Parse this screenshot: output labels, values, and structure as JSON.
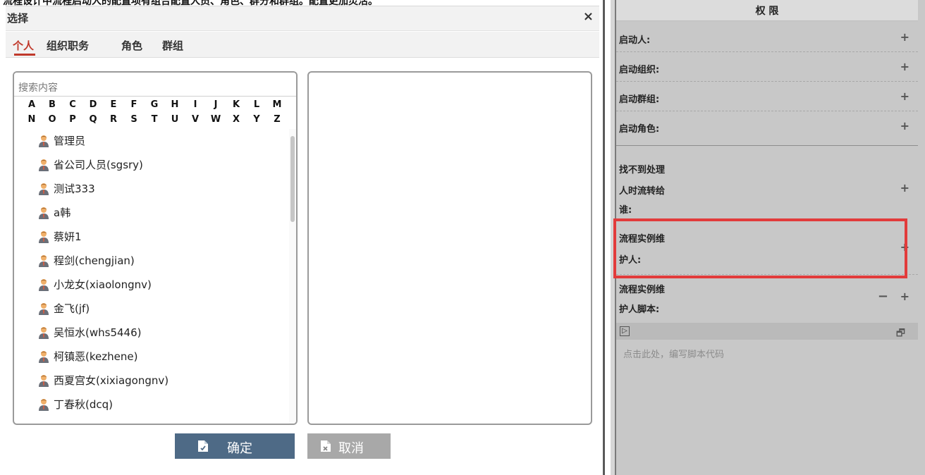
{
  "banner": {
    "text": "流程设计中流程启动人的配置项有组合配置人员、角色、群分和群组。配置更加灵活。"
  },
  "dialog": {
    "title": "选择",
    "close_symbol": "×",
    "tabs": [
      {
        "label": "个人",
        "active": true
      },
      {
        "label": "组织职务",
        "active": false
      },
      {
        "label": "角色",
        "active": false
      },
      {
        "label": "群组",
        "active": false
      }
    ],
    "search_placeholder": "搜索内容",
    "alphabet_row1": [
      "A",
      "B",
      "C",
      "D",
      "E",
      "F",
      "G",
      "H",
      "I",
      "J",
      "K",
      "L",
      "M"
    ],
    "alphabet_row2": [
      "N",
      "O",
      "P",
      "Q",
      "R",
      "S",
      "T",
      "U",
      "V",
      "W",
      "X",
      "Y",
      "Z"
    ],
    "users": [
      "管理员",
      "省公司人员(sgsry)",
      "测试333",
      "a韩",
      "蔡妍1",
      "程剑(chengjian)",
      "小龙女(xiaolongnv)",
      "金飞(jf)",
      "吴恒水(whs5446)",
      "柯镇恶(kezhene)",
      "西夏宫女(xixiagongnv)",
      "丁春秋(dcq)"
    ],
    "buttons": {
      "ok": "确定",
      "cancel": "取消"
    }
  },
  "permissions": {
    "header": "权 限",
    "start_user_label": "启动人:",
    "start_org_label": "启动组织:",
    "start_group_label": "启动群组:",
    "start_role_label": "启动角色:",
    "fallback_label_line1": "找不到处理",
    "fallback_label_line2": "人时流转给",
    "fallback_label_line3": "谁:",
    "maintainer_label_line1": "流程实例维",
    "maintainer_label_line2": "护人:",
    "maintainer_script_label_line1": "流程实例维",
    "maintainer_script_label_line2": "护人脚本:",
    "plus_symbol": "+",
    "minus_symbol": "−",
    "script_expand_symbol": "▷",
    "script_max_symbol": "🗗",
    "script_placeholder": "点击此处，编写脚本代码"
  },
  "colors": {
    "tab_active": "#c0392b",
    "ok_button": "#4e6a86",
    "cancel_button": "#a8a8a8",
    "highlight_border": "#e23b3b",
    "panel_bg": "#c8c8c8"
  }
}
